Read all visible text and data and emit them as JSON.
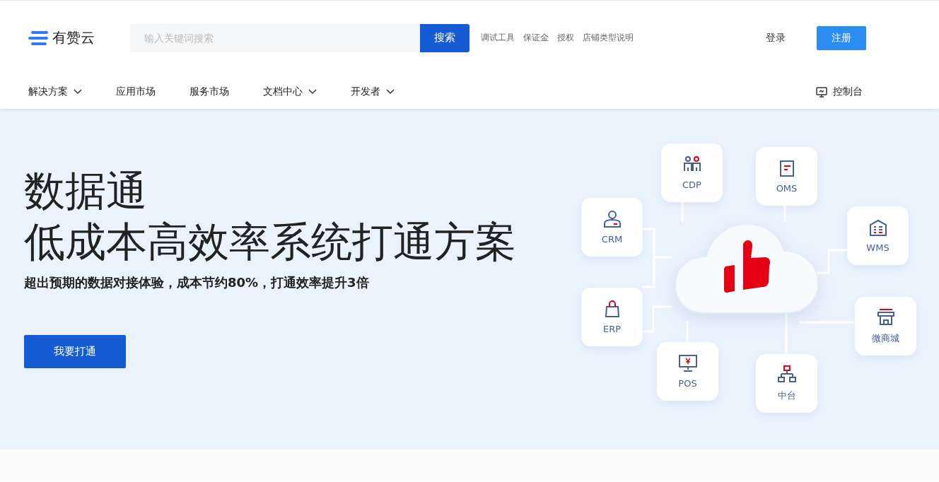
{
  "header": {
    "logo": "有赞云",
    "search": {
      "placeholder": "输入关键词搜索",
      "button": "搜索"
    },
    "quick_links": [
      "调试工具",
      "保证金",
      "授权",
      "店铺类型说明"
    ],
    "login": "登录",
    "register": "注册"
  },
  "nav": {
    "items": [
      {
        "label": "解决方案",
        "has_menu": true
      },
      {
        "label": "应用市场",
        "has_menu": false
      },
      {
        "label": "服务市场",
        "has_menu": false
      },
      {
        "label": "文档中心",
        "has_menu": true
      },
      {
        "label": "开发者",
        "has_menu": true
      }
    ],
    "console": "控制台"
  },
  "hero": {
    "title": "数据通",
    "subtitle": "低成本高效率系统打通方案",
    "description": "超出预期的数据对接体验，成本节约80%，打通效率提升3倍",
    "button": "我要打通"
  },
  "diagram": {
    "nodes": [
      {
        "label": "CDP"
      },
      {
        "label": "OMS"
      },
      {
        "label": "CRM"
      },
      {
        "label": "WMS"
      },
      {
        "label": "ERP"
      },
      {
        "label": "微商城"
      },
      {
        "label": "POS"
      },
      {
        "label": "中台"
      }
    ]
  }
}
